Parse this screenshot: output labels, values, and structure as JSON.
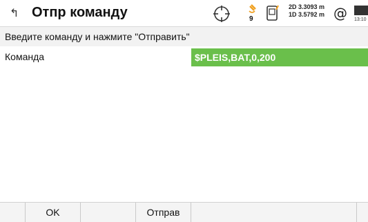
{
  "header": {
    "title": "Отпр команду",
    "back_icon": "back-arrow-icon",
    "satellite_count": "9",
    "precision_2d": "2D 3.3093 m",
    "precision_1d": "1D 3.5792 m",
    "at_symbol": "@",
    "battery_time": "13:10"
  },
  "instruction": "Введите команду и нажмите \"Отправить\"",
  "field": {
    "label": "Команда",
    "value": "$PLEIS,BAT,0,200",
    "highlight_color": "#6abf4b"
  },
  "footer": {
    "ok_label": "OK",
    "send_label": "Отправ"
  }
}
